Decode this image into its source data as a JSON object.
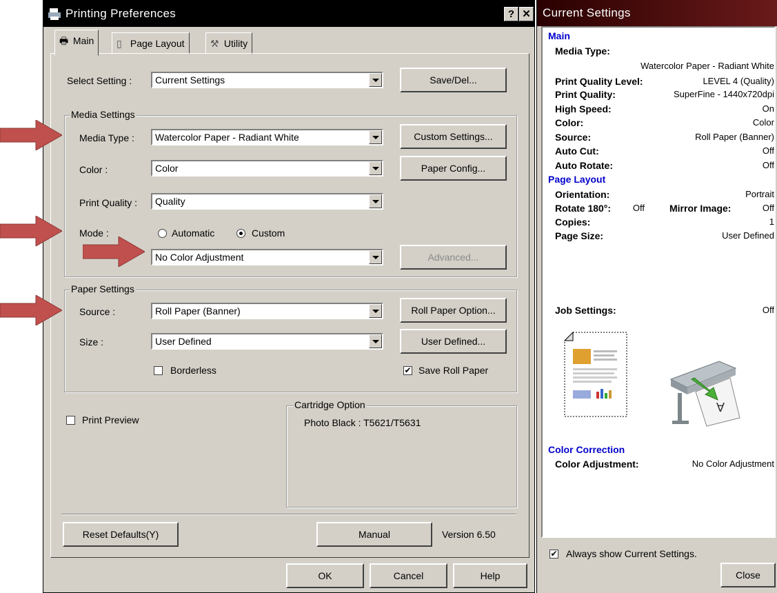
{
  "dialog": {
    "title": "Printing Preferences",
    "help_btn": "?",
    "close_btn": "✕",
    "tabs": [
      "Main",
      "Page Layout",
      "Utility"
    ],
    "select_setting_label": "Select Setting :",
    "select_setting_value": "Current Settings",
    "save_del_button": "Save/Del...",
    "media_settings": {
      "legend": "Media Settings",
      "media_type_label": "Media Type :",
      "media_type_value": "Watercolor Paper - Radiant White",
      "custom_settings_button": "Custom Settings...",
      "color_label": "Color :",
      "color_value": "Color",
      "paper_config_button": "Paper Config...",
      "print_quality_label": "Print Quality :",
      "print_quality_value": "Quality",
      "mode_label": "Mode :",
      "mode_automatic": "Automatic",
      "mode_custom": "Custom",
      "color_adjustment_value": "No Color Adjustment",
      "advanced_button": "Advanced..."
    },
    "paper_settings": {
      "legend": "Paper Settings",
      "source_label": "Source :",
      "source_value": "Roll Paper (Banner)",
      "roll_paper_option_button": "Roll Paper Option...",
      "size_label": "Size :",
      "size_value": "User Defined",
      "user_defined_button": "User Defined...",
      "borderless_label": "Borderless",
      "save_roll_paper_label": "Save Roll Paper"
    },
    "print_preview_label": "Print Preview",
    "cartridge_option": {
      "legend": "Cartridge Option",
      "text": "Photo Black : T5621/T5631"
    },
    "reset_defaults_button": "Reset Defaults(Y)",
    "manual_button": "Manual",
    "version_text": "Version 6.50",
    "ok_button": "OK",
    "cancel_button": "Cancel",
    "help_button": "Help"
  },
  "current_settings": {
    "title": "Current Settings",
    "main_header": "Main",
    "media_type_key": "Media Type:",
    "media_type_val": "Watercolor Paper - Radiant White",
    "pq_level_key": "Print Quality Level:",
    "pq_level_val": "LEVEL 4 (Quality)",
    "pq_key": "Print Quality:",
    "pq_val": "SuperFine - 1440x720dpi",
    "high_speed_key": "High Speed:",
    "high_speed_val": "On",
    "color_key": "Color:",
    "color_val": "Color",
    "source_key": "Source:",
    "source_val": "Roll Paper (Banner)",
    "auto_cut_key": "Auto Cut:",
    "auto_cut_val": "Off",
    "auto_rotate_key": "Auto Rotate:",
    "auto_rotate_val": "Off",
    "page_layout_header": "Page Layout",
    "orientation_key": "Orientation:",
    "orientation_val": "Portrait",
    "rotate_key": "Rotate 180°:",
    "rotate_val": "Off",
    "mirror_key": "Mirror Image:",
    "mirror_val": "Off",
    "copies_key": "Copies:",
    "copies_val": "1",
    "page_size_key": "Page Size:",
    "page_size_val": "User Defined",
    "job_settings_key": "Job Settings:",
    "job_settings_val": "Off",
    "color_correction_header": "Color Correction",
    "color_adj_key": "Color Adjustment:",
    "color_adj_val": "No Color Adjustment",
    "always_show_label": "Always show Current Settings.",
    "close_button": "Close"
  },
  "colors": {
    "arrow": "#c0504d",
    "accent_blue": "#0000cc"
  }
}
